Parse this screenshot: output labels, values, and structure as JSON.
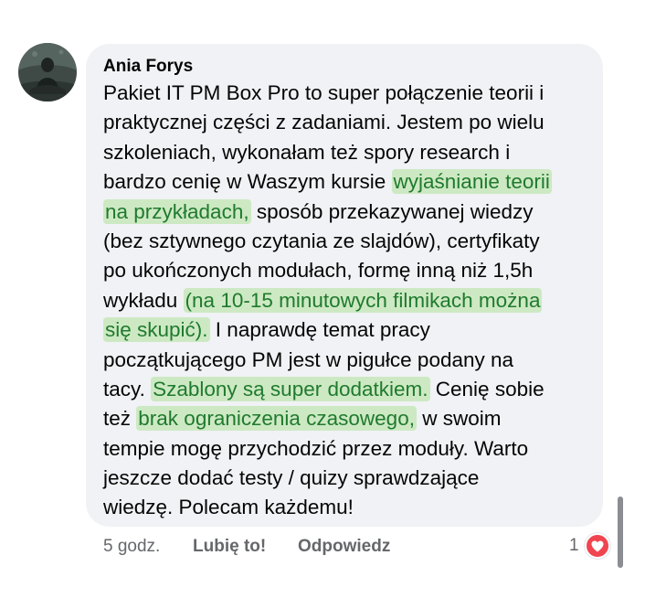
{
  "comment": {
    "author": "Ania Forys",
    "lines": [
      [
        {
          "t": "Pakiet IT PM Box Pro to super połączenie teorii i"
        }
      ],
      [
        {
          "t": "praktycznej części z zadaniami. Jestem po wielu"
        }
      ],
      [
        {
          "t": "szkoleniach, wykonałam też spory research i"
        }
      ],
      [
        {
          "t": "bardzo cenię w Waszym kursie "
        },
        {
          "t": "wyjaśnianie teorii",
          "hl": true
        }
      ],
      [
        {
          "t": "na przykładach,",
          "hl": true
        },
        {
          "t": " sposób przekazywanej wiedzy"
        }
      ],
      [
        {
          "t": "(bez sztywnego czytania ze slajdów), certyfikaty"
        }
      ],
      [
        {
          "t": "po ukończonych modułach, formę inną niż 1,5h"
        }
      ],
      [
        {
          "t": "wykładu "
        },
        {
          "t": "(na 10-15 minutowych filmikach można",
          "hl": true
        }
      ],
      [
        {
          "t": "się skupić).",
          "hl": true
        },
        {
          "t": " I naprawdę temat pracy"
        }
      ],
      [
        {
          "t": "początkującego PM jest w pigułce podany na"
        }
      ],
      [
        {
          "t": "tacy. "
        },
        {
          "t": "Szablony są super dodatkiem.",
          "hl": true
        },
        {
          "t": " Cenię sobie"
        }
      ],
      [
        {
          "t": "też "
        },
        {
          "t": "brak ograniczenia czasowego,",
          "hl": true
        },
        {
          "t": " w swoim"
        }
      ],
      [
        {
          "t": "tempie mogę przychodzić przez moduły. Warto"
        }
      ],
      [
        {
          "t": "jeszcze dodać testy / quizy sprawdzające"
        }
      ],
      [
        {
          "t": "wiedzę. Polecam każdemu!"
        }
      ]
    ]
  },
  "actions": {
    "time": "5 godz.",
    "like_label": "Lubię to!",
    "reply_label": "Odpowiedz"
  },
  "reactions": {
    "count": "1",
    "icon": "heart-reaction-icon",
    "color": "#f0454f"
  },
  "colors": {
    "highlight_bg": "#cde9c3",
    "highlight_text": "#1f7a2e",
    "bubble_bg": "#f0f2f5"
  }
}
